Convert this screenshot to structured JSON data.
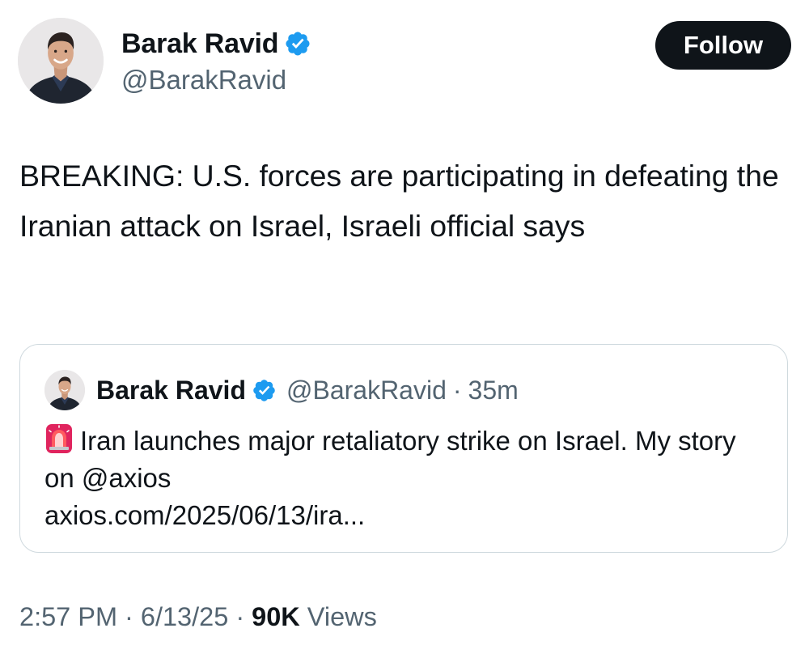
{
  "author": {
    "name": "Barak Ravid",
    "handle": "@BarakRavid",
    "verified": true,
    "verified_icon": "verified-badge-icon",
    "verified_color": "#1d9bf0"
  },
  "follow_button": {
    "label": "Follow",
    "background": "#0f1419"
  },
  "tweet": {
    "text": "BREAKING: U.S. forces are participating in defeating the Iranian attack on Israel, Israeli official says"
  },
  "quoted_tweet": {
    "author_name": "Barak Ravid",
    "handle": "@BarakRavid",
    "separator": "·",
    "time": "35m",
    "icon": "siren-icon",
    "text": "Iran launches major retaliatory strike on Israel. My story on @axios",
    "link_text": "axios.com/2025/06/13/ira..."
  },
  "meta": {
    "time": "2:57 PM",
    "date": "6/13/25",
    "separator": "·",
    "views_count": "90K",
    "views_label": "Views"
  },
  "colors": {
    "text": "#0f1419",
    "secondary": "#536471",
    "border": "#cfd9de"
  }
}
